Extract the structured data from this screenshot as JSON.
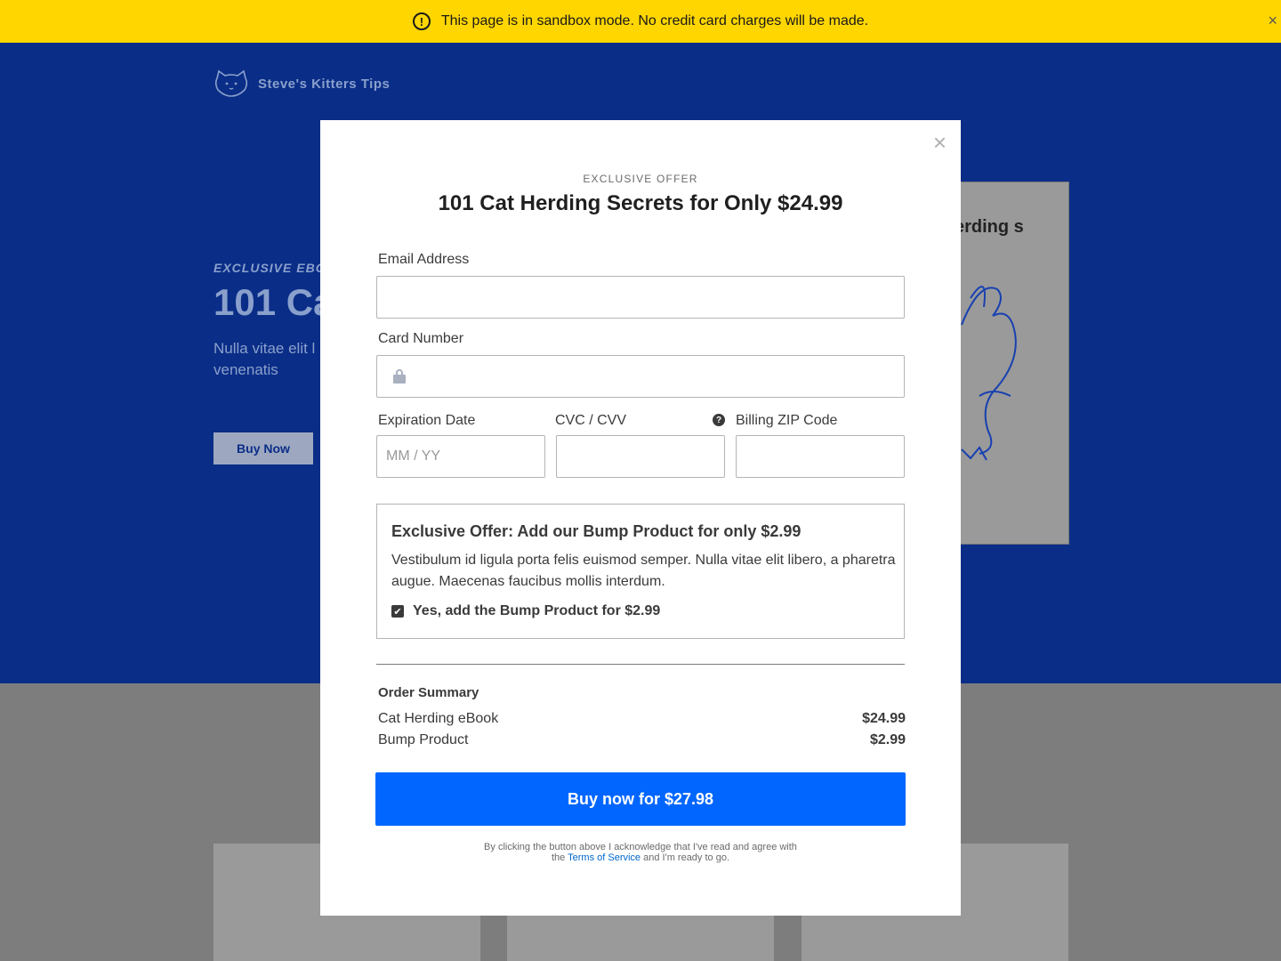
{
  "banner": {
    "message": "This page is in sandbox mode. No credit card charges will be made.",
    "warn_icon": "!",
    "close_icon": "×",
    "color": "#ffd600"
  },
  "background": {
    "brand": "Steve's Kitters Tips",
    "hero_eyebrow": "EXCLUSIVE EBO",
    "hero_title": "101 Ca",
    "hero_text": "Nulla vitae elit l magna, vel sce ante venenatis",
    "hero_button": "Buy Now",
    "book_title": "erding s",
    "hero_color": "#0a2d87"
  },
  "modal": {
    "close_icon": "×",
    "eyebrow": "EXCLUSIVE OFFER",
    "title": "101 Cat Herding Secrets for Only $24.99",
    "email": {
      "label": "Email Address",
      "value": ""
    },
    "card_number": {
      "label": "Card Number",
      "value": ""
    },
    "expiration": {
      "label": "Expiration Date",
      "placeholder": "MM / YY"
    },
    "cvc": {
      "label": "CVC / CVV",
      "help_icon": "?"
    },
    "zip": {
      "label": "Billing ZIP Code"
    },
    "bump": {
      "heading": "Exclusive Offer: Add our Bump Product for only $2.99",
      "text": "Vestibulum id ligula porta felis euismod semper. Nulla vitae elit libero, a pharetra augue. Maecenas faucibus mollis interdum.",
      "checkbox_label": "Yes, add the Bump Product for $2.99",
      "checked": true,
      "check_glyph": "✔"
    },
    "summary": {
      "heading": "Order Summary",
      "items": [
        {
          "name": "Cat Herding eBook",
          "price": "$24.99"
        },
        {
          "name": "Bump Product",
          "price": "$2.99"
        }
      ]
    },
    "buy_button": "Buy now for $27.98",
    "accent_color": "#0066ff",
    "legal": {
      "before": "By clicking the button above I acknowledge that I've read and agree with the",
      "link": "Terms of Service",
      "after": "and I'm ready to go."
    }
  }
}
